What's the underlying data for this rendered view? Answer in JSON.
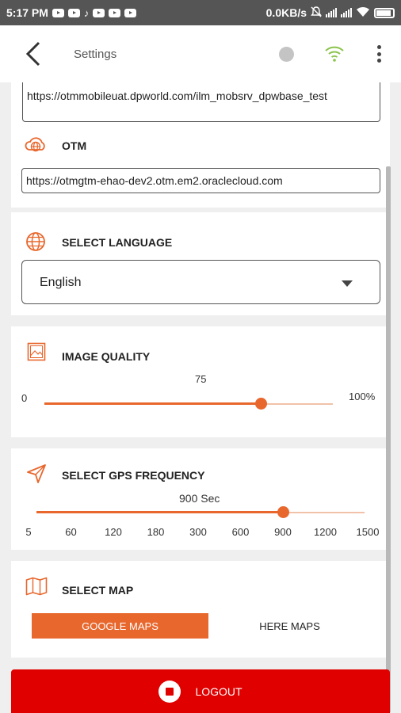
{
  "status_bar": {
    "time": "5:17 PM",
    "network_speed": "0.0KB/s"
  },
  "app_bar": {
    "title": "Settings",
    "icons": [
      "back-arrow",
      "status-dot",
      "wifi",
      "more-vertical"
    ],
    "wifi_color": "#8bc34a"
  },
  "server": {
    "url_value": "https://otmmobileuat.dpworld.com/ilm_mobsrv_dpwbase_test"
  },
  "otm": {
    "label": "OTM",
    "url_value": "https://otmgtm-ehao-dev2.otm.em2.oraclecloud.com"
  },
  "language": {
    "label": "SELECT LANGUAGE",
    "selected": "English"
  },
  "image_quality": {
    "label": "IMAGE QUALITY",
    "value_label": "75",
    "min_label": "0",
    "max_label": "100%",
    "value_fraction": 0.75
  },
  "gps_frequency": {
    "label": "SELECT GPS FREQUENCY",
    "value_label": "900 Sec",
    "ticks": [
      "5",
      "60",
      "120",
      "180",
      "300",
      "600",
      "900",
      "1200",
      "1500"
    ],
    "selected_index": 6
  },
  "map": {
    "label": "SELECT MAP",
    "options": [
      "GOOGLE MAPS",
      "HERE MAPS"
    ],
    "selected": "GOOGLE MAPS"
  },
  "logout": {
    "label": "LOGOUT"
  },
  "colors": {
    "accent": "#e8672d",
    "logout": "#e00000"
  }
}
